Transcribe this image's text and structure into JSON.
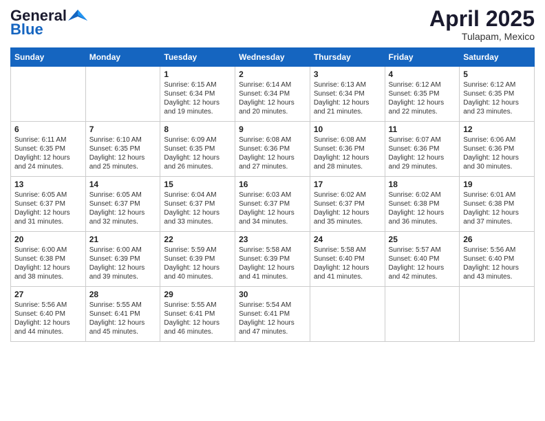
{
  "logo": {
    "general": "General",
    "blue": "Blue"
  },
  "header": {
    "month": "April 2025",
    "location": "Tulapam, Mexico"
  },
  "days_of_week": [
    "Sunday",
    "Monday",
    "Tuesday",
    "Wednesday",
    "Thursday",
    "Friday",
    "Saturday"
  ],
  "weeks": [
    [
      {
        "day": "",
        "sunrise": "",
        "sunset": "",
        "daylight": ""
      },
      {
        "day": "",
        "sunrise": "",
        "sunset": "",
        "daylight": ""
      },
      {
        "day": "1",
        "sunrise": "Sunrise: 6:15 AM",
        "sunset": "Sunset: 6:34 PM",
        "daylight": "Daylight: 12 hours and 19 minutes."
      },
      {
        "day": "2",
        "sunrise": "Sunrise: 6:14 AM",
        "sunset": "Sunset: 6:34 PM",
        "daylight": "Daylight: 12 hours and 20 minutes."
      },
      {
        "day": "3",
        "sunrise": "Sunrise: 6:13 AM",
        "sunset": "Sunset: 6:34 PM",
        "daylight": "Daylight: 12 hours and 21 minutes."
      },
      {
        "day": "4",
        "sunrise": "Sunrise: 6:12 AM",
        "sunset": "Sunset: 6:35 PM",
        "daylight": "Daylight: 12 hours and 22 minutes."
      },
      {
        "day": "5",
        "sunrise": "Sunrise: 6:12 AM",
        "sunset": "Sunset: 6:35 PM",
        "daylight": "Daylight: 12 hours and 23 minutes."
      }
    ],
    [
      {
        "day": "6",
        "sunrise": "Sunrise: 6:11 AM",
        "sunset": "Sunset: 6:35 PM",
        "daylight": "Daylight: 12 hours and 24 minutes."
      },
      {
        "day": "7",
        "sunrise": "Sunrise: 6:10 AM",
        "sunset": "Sunset: 6:35 PM",
        "daylight": "Daylight: 12 hours and 25 minutes."
      },
      {
        "day": "8",
        "sunrise": "Sunrise: 6:09 AM",
        "sunset": "Sunset: 6:35 PM",
        "daylight": "Daylight: 12 hours and 26 minutes."
      },
      {
        "day": "9",
        "sunrise": "Sunrise: 6:08 AM",
        "sunset": "Sunset: 6:36 PM",
        "daylight": "Daylight: 12 hours and 27 minutes."
      },
      {
        "day": "10",
        "sunrise": "Sunrise: 6:08 AM",
        "sunset": "Sunset: 6:36 PM",
        "daylight": "Daylight: 12 hours and 28 minutes."
      },
      {
        "day": "11",
        "sunrise": "Sunrise: 6:07 AM",
        "sunset": "Sunset: 6:36 PM",
        "daylight": "Daylight: 12 hours and 29 minutes."
      },
      {
        "day": "12",
        "sunrise": "Sunrise: 6:06 AM",
        "sunset": "Sunset: 6:36 PM",
        "daylight": "Daylight: 12 hours and 30 minutes."
      }
    ],
    [
      {
        "day": "13",
        "sunrise": "Sunrise: 6:05 AM",
        "sunset": "Sunset: 6:37 PM",
        "daylight": "Daylight: 12 hours and 31 minutes."
      },
      {
        "day": "14",
        "sunrise": "Sunrise: 6:05 AM",
        "sunset": "Sunset: 6:37 PM",
        "daylight": "Daylight: 12 hours and 32 minutes."
      },
      {
        "day": "15",
        "sunrise": "Sunrise: 6:04 AM",
        "sunset": "Sunset: 6:37 PM",
        "daylight": "Daylight: 12 hours and 33 minutes."
      },
      {
        "day": "16",
        "sunrise": "Sunrise: 6:03 AM",
        "sunset": "Sunset: 6:37 PM",
        "daylight": "Daylight: 12 hours and 34 minutes."
      },
      {
        "day": "17",
        "sunrise": "Sunrise: 6:02 AM",
        "sunset": "Sunset: 6:37 PM",
        "daylight": "Daylight: 12 hours and 35 minutes."
      },
      {
        "day": "18",
        "sunrise": "Sunrise: 6:02 AM",
        "sunset": "Sunset: 6:38 PM",
        "daylight": "Daylight: 12 hours and 36 minutes."
      },
      {
        "day": "19",
        "sunrise": "Sunrise: 6:01 AM",
        "sunset": "Sunset: 6:38 PM",
        "daylight": "Daylight: 12 hours and 37 minutes."
      }
    ],
    [
      {
        "day": "20",
        "sunrise": "Sunrise: 6:00 AM",
        "sunset": "Sunset: 6:38 PM",
        "daylight": "Daylight: 12 hours and 38 minutes."
      },
      {
        "day": "21",
        "sunrise": "Sunrise: 6:00 AM",
        "sunset": "Sunset: 6:39 PM",
        "daylight": "Daylight: 12 hours and 39 minutes."
      },
      {
        "day": "22",
        "sunrise": "Sunrise: 5:59 AM",
        "sunset": "Sunset: 6:39 PM",
        "daylight": "Daylight: 12 hours and 40 minutes."
      },
      {
        "day": "23",
        "sunrise": "Sunrise: 5:58 AM",
        "sunset": "Sunset: 6:39 PM",
        "daylight": "Daylight: 12 hours and 41 minutes."
      },
      {
        "day": "24",
        "sunrise": "Sunrise: 5:58 AM",
        "sunset": "Sunset: 6:40 PM",
        "daylight": "Daylight: 12 hours and 41 minutes."
      },
      {
        "day": "25",
        "sunrise": "Sunrise: 5:57 AM",
        "sunset": "Sunset: 6:40 PM",
        "daylight": "Daylight: 12 hours and 42 minutes."
      },
      {
        "day": "26",
        "sunrise": "Sunrise: 5:56 AM",
        "sunset": "Sunset: 6:40 PM",
        "daylight": "Daylight: 12 hours and 43 minutes."
      }
    ],
    [
      {
        "day": "27",
        "sunrise": "Sunrise: 5:56 AM",
        "sunset": "Sunset: 6:40 PM",
        "daylight": "Daylight: 12 hours and 44 minutes."
      },
      {
        "day": "28",
        "sunrise": "Sunrise: 5:55 AM",
        "sunset": "Sunset: 6:41 PM",
        "daylight": "Daylight: 12 hours and 45 minutes."
      },
      {
        "day": "29",
        "sunrise": "Sunrise: 5:55 AM",
        "sunset": "Sunset: 6:41 PM",
        "daylight": "Daylight: 12 hours and 46 minutes."
      },
      {
        "day": "30",
        "sunrise": "Sunrise: 5:54 AM",
        "sunset": "Sunset: 6:41 PM",
        "daylight": "Daylight: 12 hours and 47 minutes."
      },
      {
        "day": "",
        "sunrise": "",
        "sunset": "",
        "daylight": ""
      },
      {
        "day": "",
        "sunrise": "",
        "sunset": "",
        "daylight": ""
      },
      {
        "day": "",
        "sunrise": "",
        "sunset": "",
        "daylight": ""
      }
    ]
  ]
}
